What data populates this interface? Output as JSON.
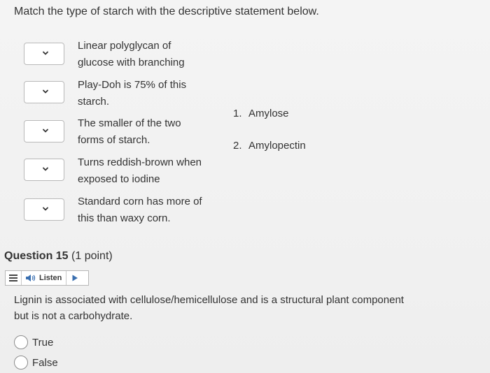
{
  "instructions": "Match the type of starch with the descriptive statement below.",
  "match_items": [
    {
      "statement_line1": "Linear polyglycan of",
      "statement_line2": "glucose with branching",
      "selected": ""
    },
    {
      "statement_line1": "Play-Doh is 75% of this",
      "statement_line2": "starch.",
      "selected": ""
    },
    {
      "statement_line1": "The smaller of the two",
      "statement_line2": "forms of starch.",
      "selected": ""
    },
    {
      "statement_line1": "Turns reddish-brown when",
      "statement_line2": "exposed to iodine",
      "selected": ""
    },
    {
      "statement_line1": "Standard corn has more of",
      "statement_line2": "this than waxy corn.",
      "selected": ""
    }
  ],
  "answers": [
    {
      "number": "1.",
      "label": "Amylose"
    },
    {
      "number": "2.",
      "label": "Amylopectin"
    }
  ],
  "question15": {
    "title": "Question 15",
    "points": "(1 point)",
    "listen_label": "Listen",
    "body_line1": "Lignin is associated with cellulose/hemicellulose and is a structural plant component",
    "body_line2": "but is not a carbohydrate.",
    "options": [
      {
        "label": "True"
      },
      {
        "label": "False"
      }
    ]
  },
  "icons": {
    "dropdown": "chevron-down-icon",
    "menu": "menu-icon",
    "speaker": "speaker-icon",
    "play": "play-icon"
  },
  "colors": {
    "accent_blue": "#3a6fb0",
    "text": "#333333",
    "border": "#b9b9b9"
  }
}
